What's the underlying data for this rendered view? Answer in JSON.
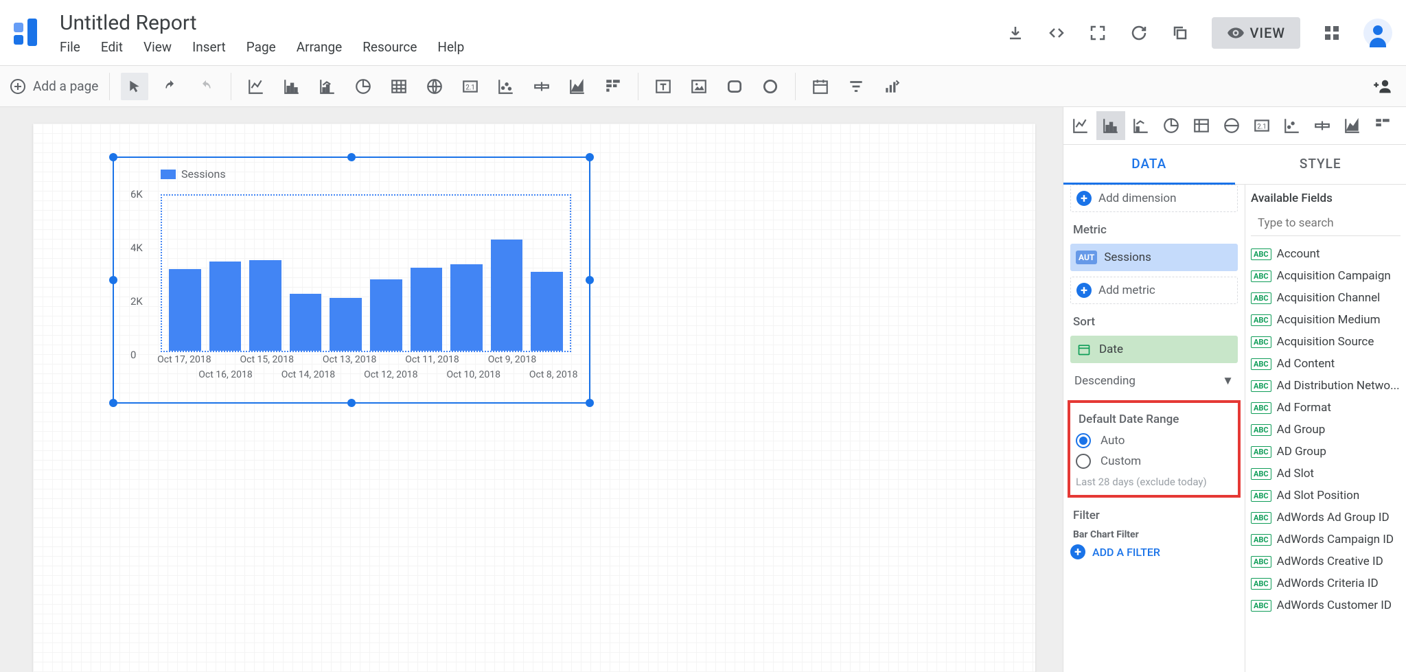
{
  "header": {
    "title": "Untitled Report",
    "menu": [
      "File",
      "Edit",
      "View",
      "Insert",
      "Page",
      "Arrange",
      "Resource",
      "Help"
    ],
    "view_button": "VIEW"
  },
  "toolbar": {
    "add_page": "Add a page"
  },
  "chart_data": {
    "type": "bar",
    "legend": "Sessions",
    "yticks": [
      "6K",
      "4K",
      "2K",
      "0"
    ],
    "ylim": [
      0,
      6000
    ],
    "categories": [
      "Oct 17, 2018",
      "Oct 16, 2018",
      "Oct 15, 2018",
      "Oct 14, 2018",
      "Oct 13, 2018",
      "Oct 12, 2018",
      "Oct 11, 2018",
      "Oct 10, 2018",
      "Oct 9, 2018",
      "Oct 8, 2018"
    ],
    "x_top": [
      "Oct 17, 2018",
      "Oct 15, 2018",
      "Oct 13, 2018",
      "Oct 11, 2018",
      "Oct 9, 2018"
    ],
    "x_bot": [
      "Oct 16, 2018",
      "Oct 14, 2018",
      "Oct 12, 2018",
      "Oct 10, 2018",
      "Oct 8, 2018"
    ],
    "values": [
      3150,
      3450,
      3500,
      2200,
      2050,
      2750,
      3200,
      3350,
      4300,
      3050
    ]
  },
  "panel": {
    "tabs": [
      "DATA",
      "STYLE"
    ],
    "active_tab": "DATA",
    "add_dimension": "Add dimension",
    "metric_label": "Metric",
    "metric_badge": "AUT",
    "metric_value": "Sessions",
    "add_metric": "Add metric",
    "sort_label": "Sort",
    "sort_value": "Date",
    "sort_direction": "Descending",
    "range_label": "Default Date Range",
    "range_auto": "Auto",
    "range_custom": "Custom",
    "range_hint": "Last 28 days (exclude today)",
    "filter_label": "Filter",
    "filter_sub": "Bar Chart Filter",
    "add_filter": "ADD A FILTER"
  },
  "fields": {
    "header": "Available Fields",
    "placeholder": "Type to search",
    "items": [
      "Account",
      "Acquisition Campaign",
      "Acquisition Channel",
      "Acquisition Medium",
      "Acquisition Source",
      "Ad Content",
      "Ad Distribution Netwo...",
      "Ad Format",
      "Ad Group",
      "AD Group",
      "Ad Slot",
      "Ad Slot Position",
      "AdWords Ad Group ID",
      "AdWords Campaign ID",
      "AdWords Creative ID",
      "AdWords Criteria ID",
      "AdWords Customer ID"
    ]
  }
}
